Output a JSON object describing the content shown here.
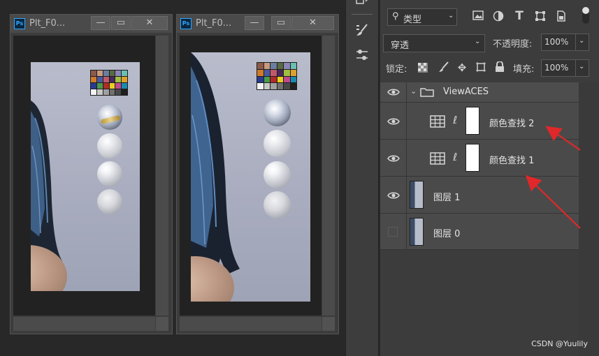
{
  "windows": [
    {
      "title": "Plt_F0...",
      "app_badge": "Ps"
    },
    {
      "title": "Plt_F0...",
      "app_badge": "Ps"
    }
  ],
  "window_buttons": {
    "minimize": "—",
    "restore": "▭",
    "close": "✕"
  },
  "color_checker": [
    "#8a5a4a",
    "#c89a80",
    "#6a7ea0",
    "#5a6a40",
    "#8a86b8",
    "#6ac0b0",
    "#d07a2a",
    "#4a5aa0",
    "#c05a6a",
    "#4a2a5a",
    "#a0c040",
    "#e0a030",
    "#2a3a90",
    "#4a9a4a",
    "#b02a2a",
    "#e8d020",
    "#c04a90",
    "#1a8ab0",
    "#f4f4f4",
    "#c8c8c8",
    "#a0a0a0",
    "#707070",
    "#484848",
    "#202020"
  ],
  "layers_panel": {
    "filter": {
      "label": "类型",
      "icon": "search-icon"
    },
    "filter_icons": [
      "image-filter-icon",
      "adjustment-filter-icon",
      "type-filter-icon",
      "shape-filter-icon",
      "smart-object-filter-icon"
    ],
    "blend_mode": "穿透",
    "opacity_label": "不透明度:",
    "opacity_value": "100%",
    "lock_label": "锁定:",
    "fill_label": "填充:",
    "fill_value": "100%",
    "layers": [
      {
        "name": "ViewACES",
        "type": "group",
        "visible": true
      },
      {
        "name": "颜色查找 2",
        "type": "adjustment",
        "visible": true
      },
      {
        "name": "颜色查找 1",
        "type": "adjustment",
        "visible": true
      },
      {
        "name": "图层 1",
        "type": "pixel",
        "visible": true
      },
      {
        "name": "图层 0",
        "type": "pixel",
        "visible": false
      }
    ]
  },
  "watermark": "CSDN @Yuulily",
  "colors": {
    "annotation_arrow": "#e0282a",
    "panel_bg": "#3c3c3c",
    "row_bg": "#4a4a4a"
  }
}
